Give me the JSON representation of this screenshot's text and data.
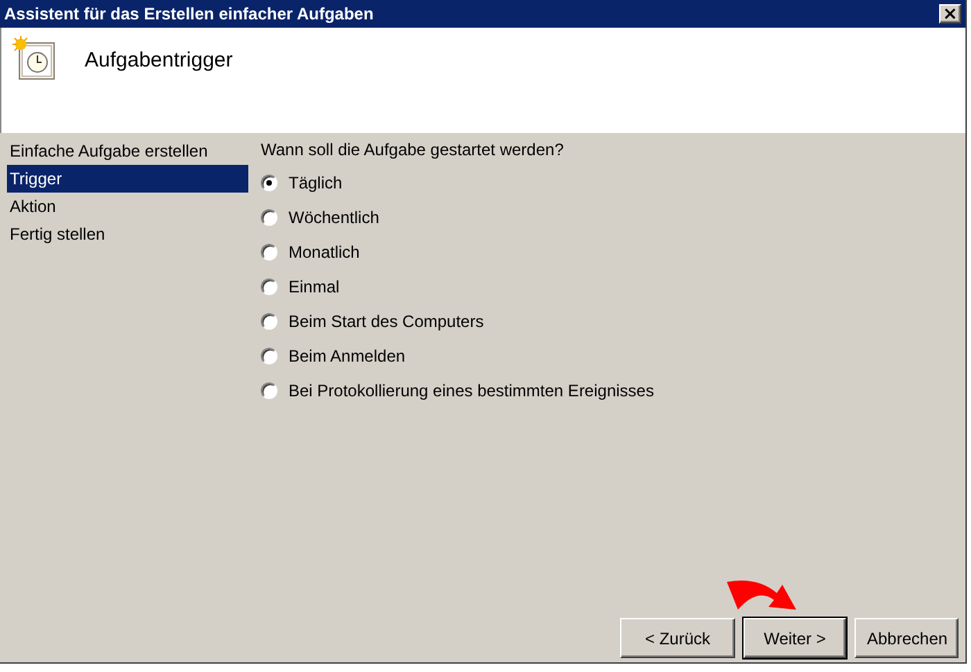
{
  "window": {
    "title": "Assistent für das Erstellen einfacher Aufgaben",
    "close": "×"
  },
  "header": {
    "title": "Aufgabentrigger"
  },
  "steps": [
    {
      "label": "Einfache Aufgabe erstellen",
      "selected": false
    },
    {
      "label": "Trigger",
      "selected": true
    },
    {
      "label": "Aktion",
      "selected": false
    },
    {
      "label": "Fertig stellen",
      "selected": false
    }
  ],
  "question": "Wann soll die Aufgabe gestartet werden?",
  "options": [
    {
      "label": "Täglich",
      "selected": true
    },
    {
      "label": "Wöchentlich",
      "selected": false
    },
    {
      "label": "Monatlich",
      "selected": false
    },
    {
      "label": "Einmal",
      "selected": false
    },
    {
      "label": "Beim Start des Computers",
      "selected": false
    },
    {
      "label": "Beim Anmelden",
      "selected": false
    },
    {
      "label": "Bei Protokollierung eines bestimmten Ereignisses",
      "selected": false
    }
  ],
  "buttons": [
    {
      "label": "< Zurück",
      "kind": "normal"
    },
    {
      "label": "Weiter >",
      "kind": "default"
    },
    {
      "label": "Abbrechen",
      "kind": "normal"
    }
  ]
}
